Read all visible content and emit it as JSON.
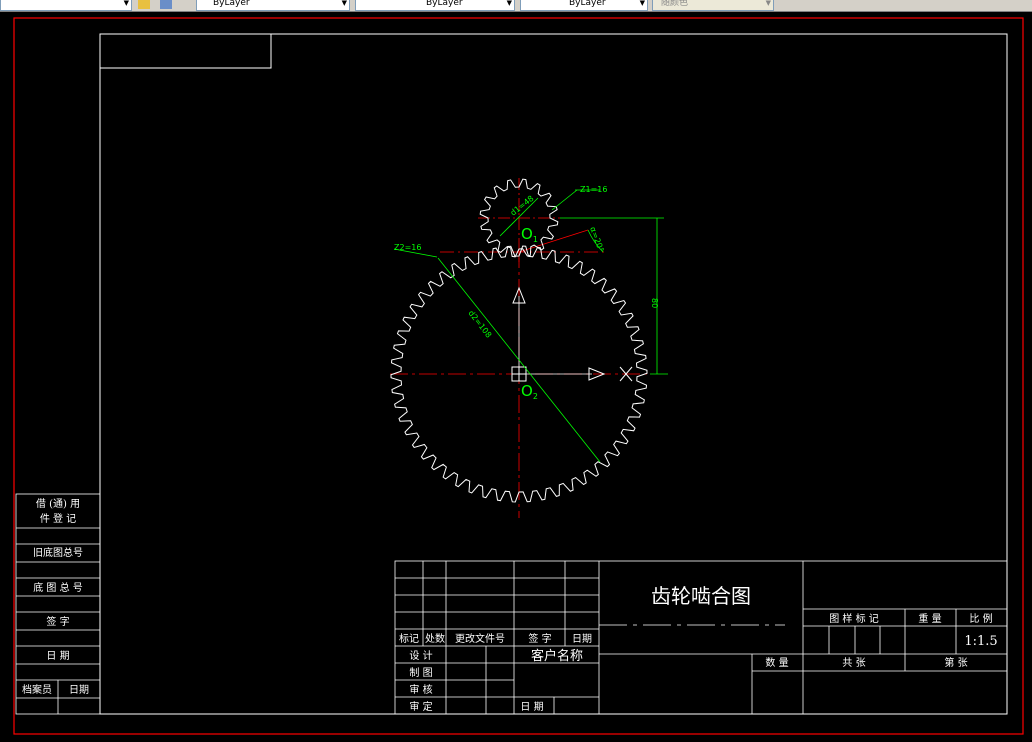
{
  "toolbar": {
    "color_control": "ByLayer",
    "linetype_control": "ByLayer",
    "lineweight_control": "ByLayer",
    "plotstyle_control": "随颜色"
  },
  "sidebar": {
    "reg_line1": "借 (通) 用",
    "reg_line2": "件 登 记",
    "old_drawing_no": "旧底图总号",
    "base_drawing_no": "底 图 总 号",
    "signature": "签 字",
    "date": "日 期",
    "archivist": "档案员",
    "archivist_date": "日期"
  },
  "title_block": {
    "drawing_title": "齿轮啮合图",
    "customer_name": "客户名称",
    "col_mark": "标记",
    "col_count": "处数",
    "col_doc": "更改文件号",
    "col_sign": "签 字",
    "col_date": "日期",
    "row_design": "设 计",
    "row_draw": "制 图",
    "row_check": "审 核",
    "row_approve": "审 定",
    "date_label": "日 期",
    "stage_mark": "图 样 标 记",
    "weight": "重 量",
    "scale_label": "比 例",
    "scale_value": "1:1.5",
    "quantity": "数 量",
    "total_sheets": "共     张",
    "sheet_no": "第     张"
  },
  "gear_labels": {
    "z1": "Z1=16",
    "z2": "Z2=16",
    "d1": "d1=48",
    "d2": "d2=108",
    "center_distance": "80",
    "angle": "α=20°",
    "o1": "O",
    "o1_sub": "1",
    "o2": "O",
    "o2_sub": "2"
  },
  "colors": {
    "background": "#000000",
    "border": "#ffffff",
    "outer_frame": "#ff0000",
    "gear": "#ffffff",
    "center_line": "#ff0000",
    "dimension": "#00ff00"
  }
}
